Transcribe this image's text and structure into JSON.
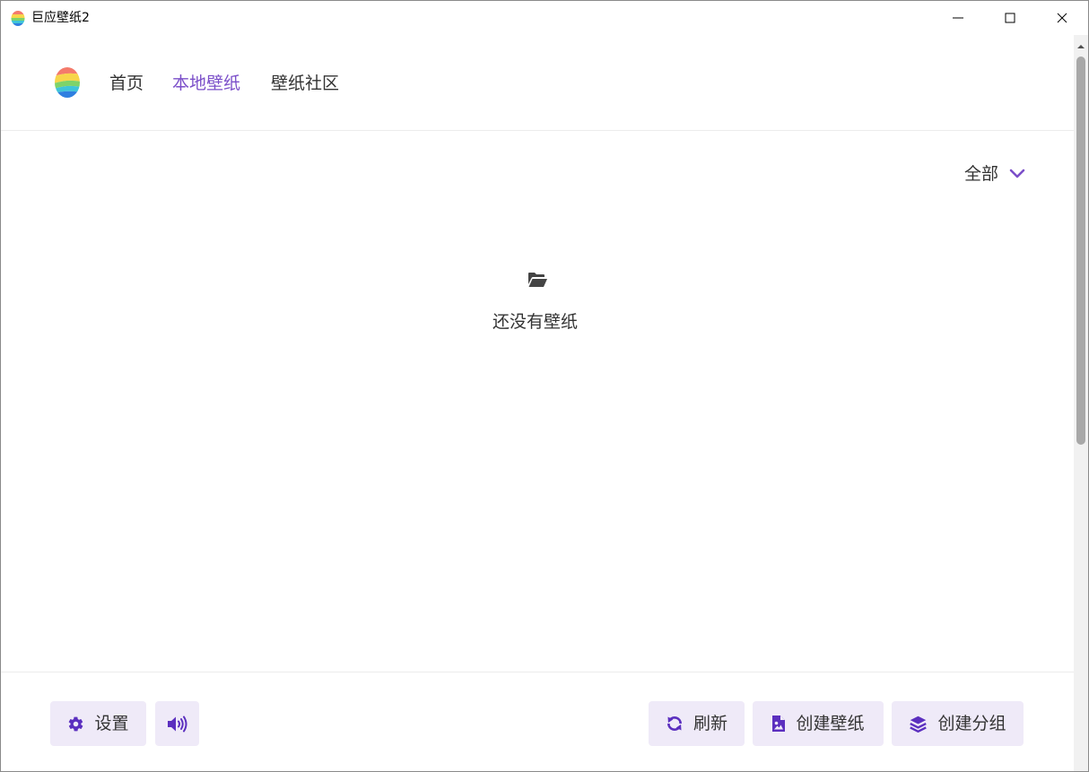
{
  "window": {
    "title": "巨应壁纸2"
  },
  "nav": {
    "items": [
      {
        "label": "首页",
        "active": false
      },
      {
        "label": "本地壁纸",
        "active": true
      },
      {
        "label": "壁纸社区",
        "active": false
      }
    ]
  },
  "content": {
    "filter_label": "全部",
    "empty_text": "还没有壁纸"
  },
  "footer": {
    "settings_label": "设置",
    "refresh_label": "刷新",
    "create_wallpaper_label": "创建壁纸",
    "create_group_label": "创建分组"
  },
  "icons": {
    "app": "egg-logo-icon",
    "filter": "chevron-down-icon",
    "empty": "folder-open-icon",
    "settings": "gear-icon",
    "sound": "volume-icon",
    "refresh": "refresh-icon",
    "create_wallpaper": "image-file-icon",
    "create_group": "layers-icon"
  },
  "colors": {
    "accent": "#7b4fc9",
    "button_bg": "#efeaf8",
    "icon_purple": "#5b2fbf",
    "text": "#333333"
  }
}
